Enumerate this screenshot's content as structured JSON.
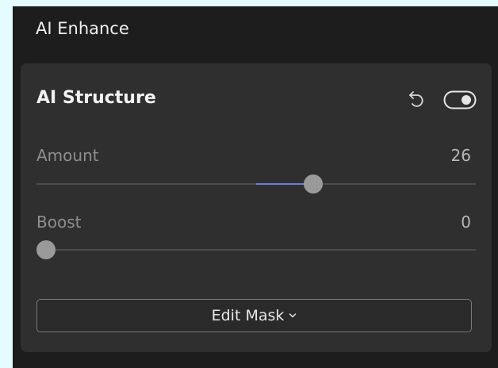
{
  "window": {
    "title": "AI Enhance"
  },
  "panel": {
    "title": "AI Structure",
    "icons": {
      "reset": "reset-icon",
      "visibility": "eye-toggle-icon"
    },
    "sliders": [
      {
        "label": "Amount",
        "value": "26",
        "level": 0.63,
        "fill_from": 0.5
      },
      {
        "label": "Boost",
        "value": "0",
        "level": 0.0,
        "fill_from": 0.0
      }
    ],
    "edit_mask": {
      "label": "Edit Mask"
    }
  },
  "colors": {
    "background": "#e4fcfe",
    "panel": "#2f2f2f",
    "accent": "#6f7ed8"
  }
}
